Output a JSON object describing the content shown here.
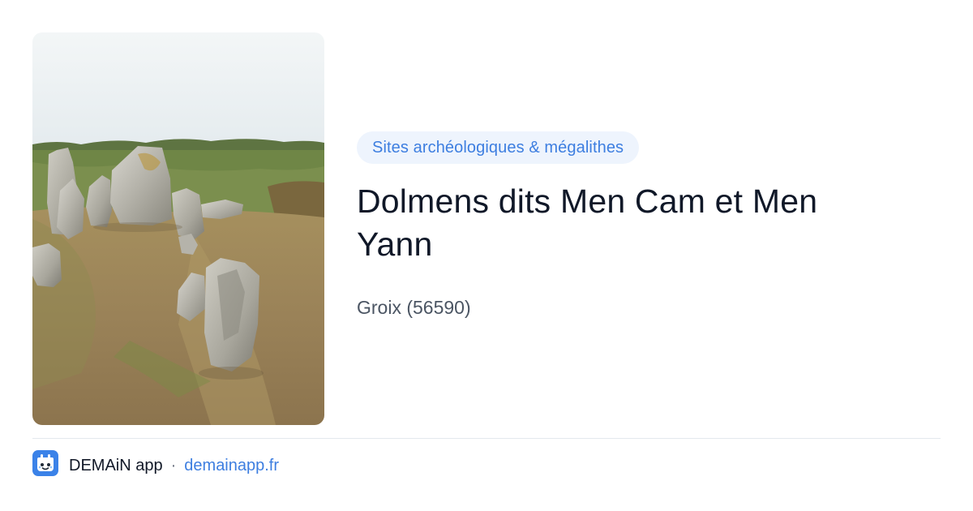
{
  "place": {
    "category": "Sites archéologiques & mégalithes",
    "title": "Dolmens dits Men Cam et Men Yann",
    "locality": "Groix (56590)"
  },
  "footer": {
    "app_name": "DEMAiN app",
    "separator": "·",
    "domain": "demainapp.fr",
    "icon": "demain-app-logo-icon"
  },
  "colors": {
    "accent": "#3d7ee0",
    "tag_background": "#eef4fd",
    "title": "#101828",
    "muted": "#4b5563"
  }
}
